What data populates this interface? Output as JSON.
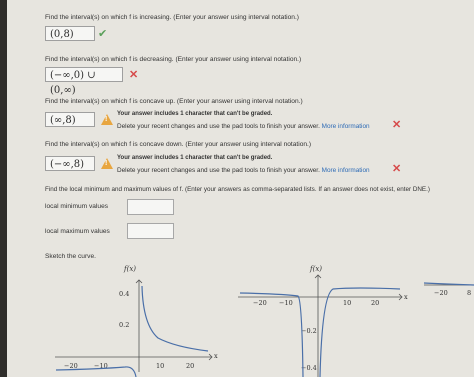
{
  "q1": {
    "text": "Find the interval(s) on which f is increasing. (Enter your answer using interval notation.)",
    "answer": "(0,8)"
  },
  "q2": {
    "text": "Find the interval(s) on which f is decreasing. (Enter your answer using interval notation.)",
    "answer": "(−∞,0) ∪ (0,∞)"
  },
  "q3": {
    "text": "Find the interval(s) on which f is concave up. (Enter your answer using interval notation.)",
    "answer": "(∞,8)"
  },
  "q4": {
    "text": "Find the interval(s) on which f is concave down. (Enter your answer using interval notation.)",
    "answer": "(−∞,8)"
  },
  "warning": {
    "title": "Your answer includes 1 character that can't be graded.",
    "body": "Delete your recent changes and use the pad tools to finish your answer.",
    "link": "More information"
  },
  "q5": {
    "text": "Find the local minimum and maximum values of f. (Enter your answers as comma-separated lists. If an answer does not exist, enter DNE.)",
    "min_label": "local minimum values",
    "max_label": "local maximum values",
    "min_value": "",
    "max_value": ""
  },
  "sketch": {
    "label": "Sketch the curve.",
    "fx_label": "f(x)",
    "x_label": "x",
    "graph1": {
      "y_ticks": [
        "0.4",
        "0.2"
      ],
      "x_ticks": [
        "−20",
        "−10",
        "10",
        "20"
      ]
    },
    "graph2": {
      "y_ticks": [
        "−0.2",
        "−0.4"
      ],
      "x_ticks": [
        "−20",
        "−10",
        "10",
        "20"
      ]
    },
    "graph3": {
      "x_ticks": [
        "−20"
      ],
      "cut_label": "8"
    }
  },
  "icons": {
    "check": "check-icon",
    "x": "x-mark-icon",
    "warning": "warning-icon",
    "close": "close-icon"
  },
  "colors": {
    "check": "#5aa05a",
    "error": "#d64a4a",
    "warning": "#e8a640",
    "link": "#2d6ab5",
    "curve": "#4a6fa8"
  }
}
